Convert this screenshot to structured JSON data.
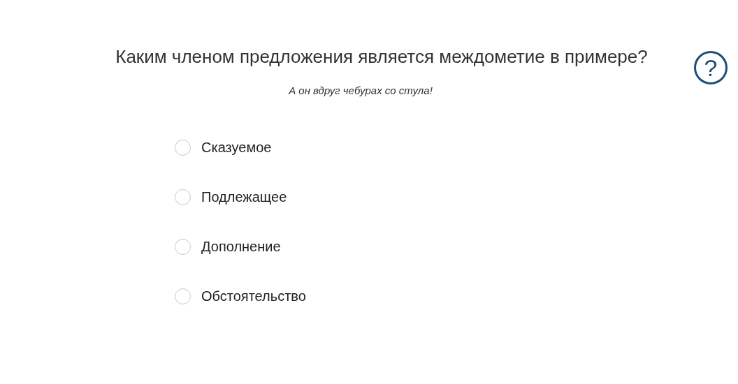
{
  "question": "Каким членом предложения является междометие в примере?",
  "example": "А он вдруг чебурах со стула!",
  "help_button": "?",
  "options": [
    {
      "label": "Сказуемое",
      "selected": false
    },
    {
      "label": "Подлежащее",
      "selected": false
    },
    {
      "label": "Дополнение",
      "selected": false
    },
    {
      "label": "Обстоятельство",
      "selected": false
    }
  ]
}
